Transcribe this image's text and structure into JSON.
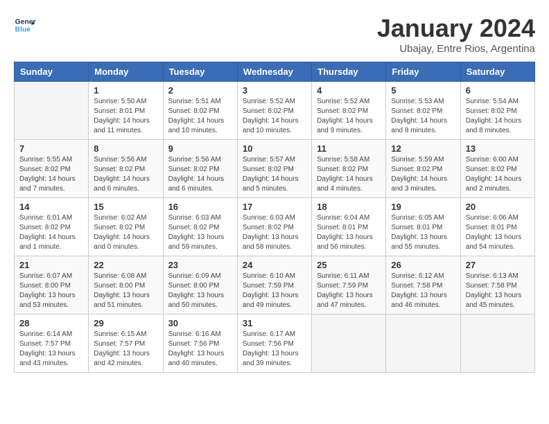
{
  "header": {
    "logo_line1": "General",
    "logo_line2": "Blue",
    "month": "January 2024",
    "location": "Ubajay, Entre Rios, Argentina"
  },
  "weekdays": [
    "Sunday",
    "Monday",
    "Tuesday",
    "Wednesday",
    "Thursday",
    "Friday",
    "Saturday"
  ],
  "weeks": [
    [
      {
        "day": "",
        "sunrise": "",
        "sunset": "",
        "daylight": ""
      },
      {
        "day": "1",
        "sunrise": "Sunrise: 5:50 AM",
        "sunset": "Sunset: 8:01 PM",
        "daylight": "Daylight: 14 hours and 11 minutes."
      },
      {
        "day": "2",
        "sunrise": "Sunrise: 5:51 AM",
        "sunset": "Sunset: 8:02 PM",
        "daylight": "Daylight: 14 hours and 10 minutes."
      },
      {
        "day": "3",
        "sunrise": "Sunrise: 5:52 AM",
        "sunset": "Sunset: 8:02 PM",
        "daylight": "Daylight: 14 hours and 10 minutes."
      },
      {
        "day": "4",
        "sunrise": "Sunrise: 5:52 AM",
        "sunset": "Sunset: 8:02 PM",
        "daylight": "Daylight: 14 hours and 9 minutes."
      },
      {
        "day": "5",
        "sunrise": "Sunrise: 5:53 AM",
        "sunset": "Sunset: 8:02 PM",
        "daylight": "Daylight: 14 hours and 8 minutes."
      },
      {
        "day": "6",
        "sunrise": "Sunrise: 5:54 AM",
        "sunset": "Sunset: 8:02 PM",
        "daylight": "Daylight: 14 hours and 8 minutes."
      }
    ],
    [
      {
        "day": "7",
        "sunrise": "Sunrise: 5:55 AM",
        "sunset": "Sunset: 8:02 PM",
        "daylight": "Daylight: 14 hours and 7 minutes."
      },
      {
        "day": "8",
        "sunrise": "Sunrise: 5:56 AM",
        "sunset": "Sunset: 8:02 PM",
        "daylight": "Daylight: 14 hours and 6 minutes."
      },
      {
        "day": "9",
        "sunrise": "Sunrise: 5:56 AM",
        "sunset": "Sunset: 8:02 PM",
        "daylight": "Daylight: 14 hours and 6 minutes."
      },
      {
        "day": "10",
        "sunrise": "Sunrise: 5:57 AM",
        "sunset": "Sunset: 8:02 PM",
        "daylight": "Daylight: 14 hours and 5 minutes."
      },
      {
        "day": "11",
        "sunrise": "Sunrise: 5:58 AM",
        "sunset": "Sunset: 8:02 PM",
        "daylight": "Daylight: 14 hours and 4 minutes."
      },
      {
        "day": "12",
        "sunrise": "Sunrise: 5:59 AM",
        "sunset": "Sunset: 8:02 PM",
        "daylight": "Daylight: 14 hours and 3 minutes."
      },
      {
        "day": "13",
        "sunrise": "Sunrise: 6:00 AM",
        "sunset": "Sunset: 8:02 PM",
        "daylight": "Daylight: 14 hours and 2 minutes."
      }
    ],
    [
      {
        "day": "14",
        "sunrise": "Sunrise: 6:01 AM",
        "sunset": "Sunset: 8:02 PM",
        "daylight": "Daylight: 14 hours and 1 minute."
      },
      {
        "day": "15",
        "sunrise": "Sunrise: 6:02 AM",
        "sunset": "Sunset: 8:02 PM",
        "daylight": "Daylight: 14 hours and 0 minutes."
      },
      {
        "day": "16",
        "sunrise": "Sunrise: 6:03 AM",
        "sunset": "Sunset: 8:02 PM",
        "daylight": "Daylight: 13 hours and 59 minutes."
      },
      {
        "day": "17",
        "sunrise": "Sunrise: 6:03 AM",
        "sunset": "Sunset: 8:02 PM",
        "daylight": "Daylight: 13 hours and 58 minutes."
      },
      {
        "day": "18",
        "sunrise": "Sunrise: 6:04 AM",
        "sunset": "Sunset: 8:01 PM",
        "daylight": "Daylight: 13 hours and 56 minutes."
      },
      {
        "day": "19",
        "sunrise": "Sunrise: 6:05 AM",
        "sunset": "Sunset: 8:01 PM",
        "daylight": "Daylight: 13 hours and 55 minutes."
      },
      {
        "day": "20",
        "sunrise": "Sunrise: 6:06 AM",
        "sunset": "Sunset: 8:01 PM",
        "daylight": "Daylight: 13 hours and 54 minutes."
      }
    ],
    [
      {
        "day": "21",
        "sunrise": "Sunrise: 6:07 AM",
        "sunset": "Sunset: 8:00 PM",
        "daylight": "Daylight: 13 hours and 53 minutes."
      },
      {
        "day": "22",
        "sunrise": "Sunrise: 6:08 AM",
        "sunset": "Sunset: 8:00 PM",
        "daylight": "Daylight: 13 hours and 51 minutes."
      },
      {
        "day": "23",
        "sunrise": "Sunrise: 6:09 AM",
        "sunset": "Sunset: 8:00 PM",
        "daylight": "Daylight: 13 hours and 50 minutes."
      },
      {
        "day": "24",
        "sunrise": "Sunrise: 6:10 AM",
        "sunset": "Sunset: 7:59 PM",
        "daylight": "Daylight: 13 hours and 49 minutes."
      },
      {
        "day": "25",
        "sunrise": "Sunrise: 6:11 AM",
        "sunset": "Sunset: 7:59 PM",
        "daylight": "Daylight: 13 hours and 47 minutes."
      },
      {
        "day": "26",
        "sunrise": "Sunrise: 6:12 AM",
        "sunset": "Sunset: 7:58 PM",
        "daylight": "Daylight: 13 hours and 46 minutes."
      },
      {
        "day": "27",
        "sunrise": "Sunrise: 6:13 AM",
        "sunset": "Sunset: 7:58 PM",
        "daylight": "Daylight: 13 hours and 45 minutes."
      }
    ],
    [
      {
        "day": "28",
        "sunrise": "Sunrise: 6:14 AM",
        "sunset": "Sunset: 7:57 PM",
        "daylight": "Daylight: 13 hours and 43 minutes."
      },
      {
        "day": "29",
        "sunrise": "Sunrise: 6:15 AM",
        "sunset": "Sunset: 7:57 PM",
        "daylight": "Daylight: 13 hours and 42 minutes."
      },
      {
        "day": "30",
        "sunrise": "Sunrise: 6:16 AM",
        "sunset": "Sunset: 7:56 PM",
        "daylight": "Daylight: 13 hours and 40 minutes."
      },
      {
        "day": "31",
        "sunrise": "Sunrise: 6:17 AM",
        "sunset": "Sunset: 7:56 PM",
        "daylight": "Daylight: 13 hours and 39 minutes."
      },
      {
        "day": "",
        "sunrise": "",
        "sunset": "",
        "daylight": ""
      },
      {
        "day": "",
        "sunrise": "",
        "sunset": "",
        "daylight": ""
      },
      {
        "day": "",
        "sunrise": "",
        "sunset": "",
        "daylight": ""
      }
    ]
  ]
}
